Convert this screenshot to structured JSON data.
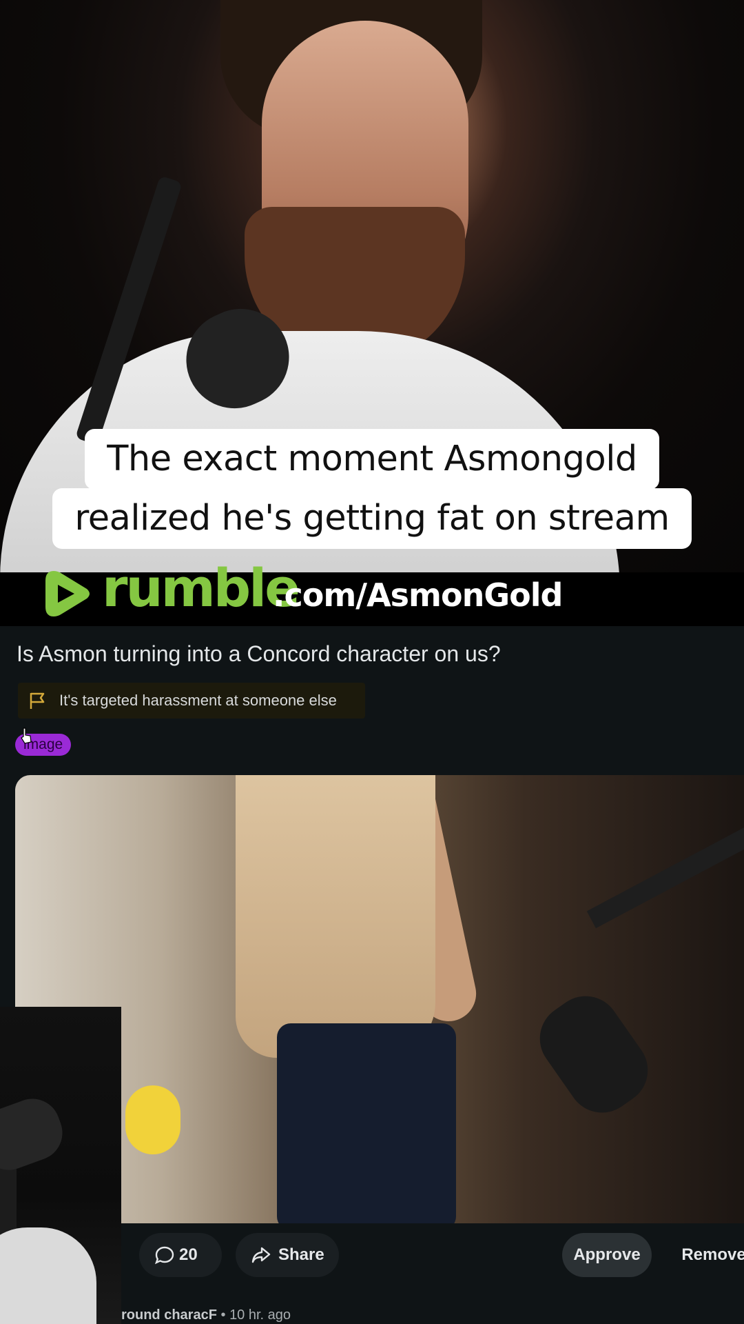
{
  "caption": {
    "line1": "The exact moment Asmongold",
    "line2": "realized he's getting fat on stream"
  },
  "watermark": {
    "brand": "rumble",
    "path": ".com/AsmonGold",
    "brand_color": "#85c742"
  },
  "post": {
    "title": "Is Asmon turning into a Concord character on us?",
    "report_reason": "It's targeted harassment at someone else",
    "flair": "image",
    "flair_color": "#9a2ad6",
    "comment_count": "20",
    "share_label": "Share",
    "approve_label": "Approve",
    "remove_label": "Remove",
    "author": "round characF",
    "separator": "•",
    "time": "10 hr. ago"
  },
  "icons": {
    "report": "flag-icon",
    "comments": "comment-bubble-icon",
    "share": "share-arrow-icon",
    "play": "play-logo-icon"
  }
}
